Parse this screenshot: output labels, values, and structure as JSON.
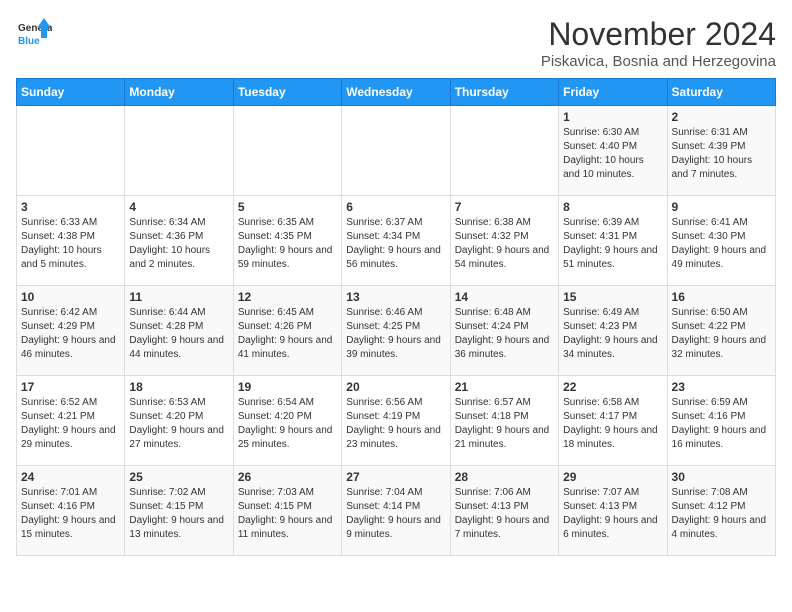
{
  "logo": {
    "line1": "General",
    "line2": "Blue"
  },
  "title": "November 2024",
  "subtitle": "Piskavica, Bosnia and Herzegovina",
  "days_of_week": [
    "Sunday",
    "Monday",
    "Tuesday",
    "Wednesday",
    "Thursday",
    "Friday",
    "Saturday"
  ],
  "weeks": [
    [
      {
        "day": "",
        "content": ""
      },
      {
        "day": "",
        "content": ""
      },
      {
        "day": "",
        "content": ""
      },
      {
        "day": "",
        "content": ""
      },
      {
        "day": "",
        "content": ""
      },
      {
        "day": "1",
        "content": "Sunrise: 6:30 AM\nSunset: 4:40 PM\nDaylight: 10 hours and 10 minutes."
      },
      {
        "day": "2",
        "content": "Sunrise: 6:31 AM\nSunset: 4:39 PM\nDaylight: 10 hours and 7 minutes."
      }
    ],
    [
      {
        "day": "3",
        "content": "Sunrise: 6:33 AM\nSunset: 4:38 PM\nDaylight: 10 hours and 5 minutes."
      },
      {
        "day": "4",
        "content": "Sunrise: 6:34 AM\nSunset: 4:36 PM\nDaylight: 10 hours and 2 minutes."
      },
      {
        "day": "5",
        "content": "Sunrise: 6:35 AM\nSunset: 4:35 PM\nDaylight: 9 hours and 59 minutes."
      },
      {
        "day": "6",
        "content": "Sunrise: 6:37 AM\nSunset: 4:34 PM\nDaylight: 9 hours and 56 minutes."
      },
      {
        "day": "7",
        "content": "Sunrise: 6:38 AM\nSunset: 4:32 PM\nDaylight: 9 hours and 54 minutes."
      },
      {
        "day": "8",
        "content": "Sunrise: 6:39 AM\nSunset: 4:31 PM\nDaylight: 9 hours and 51 minutes."
      },
      {
        "day": "9",
        "content": "Sunrise: 6:41 AM\nSunset: 4:30 PM\nDaylight: 9 hours and 49 minutes."
      }
    ],
    [
      {
        "day": "10",
        "content": "Sunrise: 6:42 AM\nSunset: 4:29 PM\nDaylight: 9 hours and 46 minutes."
      },
      {
        "day": "11",
        "content": "Sunrise: 6:44 AM\nSunset: 4:28 PM\nDaylight: 9 hours and 44 minutes."
      },
      {
        "day": "12",
        "content": "Sunrise: 6:45 AM\nSunset: 4:26 PM\nDaylight: 9 hours and 41 minutes."
      },
      {
        "day": "13",
        "content": "Sunrise: 6:46 AM\nSunset: 4:25 PM\nDaylight: 9 hours and 39 minutes."
      },
      {
        "day": "14",
        "content": "Sunrise: 6:48 AM\nSunset: 4:24 PM\nDaylight: 9 hours and 36 minutes."
      },
      {
        "day": "15",
        "content": "Sunrise: 6:49 AM\nSunset: 4:23 PM\nDaylight: 9 hours and 34 minutes."
      },
      {
        "day": "16",
        "content": "Sunrise: 6:50 AM\nSunset: 4:22 PM\nDaylight: 9 hours and 32 minutes."
      }
    ],
    [
      {
        "day": "17",
        "content": "Sunrise: 6:52 AM\nSunset: 4:21 PM\nDaylight: 9 hours and 29 minutes."
      },
      {
        "day": "18",
        "content": "Sunrise: 6:53 AM\nSunset: 4:20 PM\nDaylight: 9 hours and 27 minutes."
      },
      {
        "day": "19",
        "content": "Sunrise: 6:54 AM\nSunset: 4:20 PM\nDaylight: 9 hours and 25 minutes."
      },
      {
        "day": "20",
        "content": "Sunrise: 6:56 AM\nSunset: 4:19 PM\nDaylight: 9 hours and 23 minutes."
      },
      {
        "day": "21",
        "content": "Sunrise: 6:57 AM\nSunset: 4:18 PM\nDaylight: 9 hours and 21 minutes."
      },
      {
        "day": "22",
        "content": "Sunrise: 6:58 AM\nSunset: 4:17 PM\nDaylight: 9 hours and 18 minutes."
      },
      {
        "day": "23",
        "content": "Sunrise: 6:59 AM\nSunset: 4:16 PM\nDaylight: 9 hours and 16 minutes."
      }
    ],
    [
      {
        "day": "24",
        "content": "Sunrise: 7:01 AM\nSunset: 4:16 PM\nDaylight: 9 hours and 15 minutes."
      },
      {
        "day": "25",
        "content": "Sunrise: 7:02 AM\nSunset: 4:15 PM\nDaylight: 9 hours and 13 minutes."
      },
      {
        "day": "26",
        "content": "Sunrise: 7:03 AM\nSunset: 4:15 PM\nDaylight: 9 hours and 11 minutes."
      },
      {
        "day": "27",
        "content": "Sunrise: 7:04 AM\nSunset: 4:14 PM\nDaylight: 9 hours and 9 minutes."
      },
      {
        "day": "28",
        "content": "Sunrise: 7:06 AM\nSunset: 4:13 PM\nDaylight: 9 hours and 7 minutes."
      },
      {
        "day": "29",
        "content": "Sunrise: 7:07 AM\nSunset: 4:13 PM\nDaylight: 9 hours and 6 minutes."
      },
      {
        "day": "30",
        "content": "Sunrise: 7:08 AM\nSunset: 4:12 PM\nDaylight: 9 hours and 4 minutes."
      }
    ]
  ]
}
